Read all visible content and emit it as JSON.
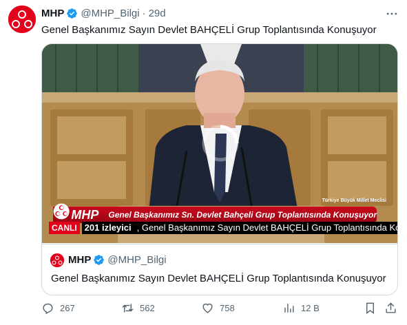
{
  "tweet": {
    "author_name": "MHP",
    "handle": "@MHP_Bilgi",
    "separator": "·",
    "time": "29d",
    "text": "Genel Başkanımız Sayın Devlet BAHÇELİ Grup Toplantısında Konuşuyor"
  },
  "video": {
    "live_label": "CANLI",
    "viewers": "201 izleyici",
    "live_title": ", Genel Başkanımız Sayın Devlet BAHÇELİ Grup Toplantısında Konuşuyor",
    "lower_third_brand": "MHP",
    "lower_third_text": "Genel Başkanımız Sn. Devlet Bahçeli Grup Toplantısında Konuşuyor",
    "channel_label": "Türkiye Büyük Millet Meclisi"
  },
  "quote": {
    "author_name": "MHP",
    "handle": "@MHP_Bilgi",
    "text": "Genel Başkanımız Sayın Devlet BAHÇELİ Grup Toplantısında Konuşuyor"
  },
  "actions": {
    "replies": "267",
    "reposts": "562",
    "likes": "758",
    "views": "12 B"
  },
  "colors": {
    "brand_red": "#e2001a",
    "verified_blue": "#1d9bf0",
    "muted_text": "#536471",
    "border": "#cfd9de"
  },
  "icons": [
    "mhp-logo-icon",
    "verified-icon",
    "more-icon",
    "reply-icon",
    "repost-icon",
    "like-icon",
    "views-icon",
    "bookmark-icon",
    "share-icon",
    "loading-spinner-icon"
  ]
}
